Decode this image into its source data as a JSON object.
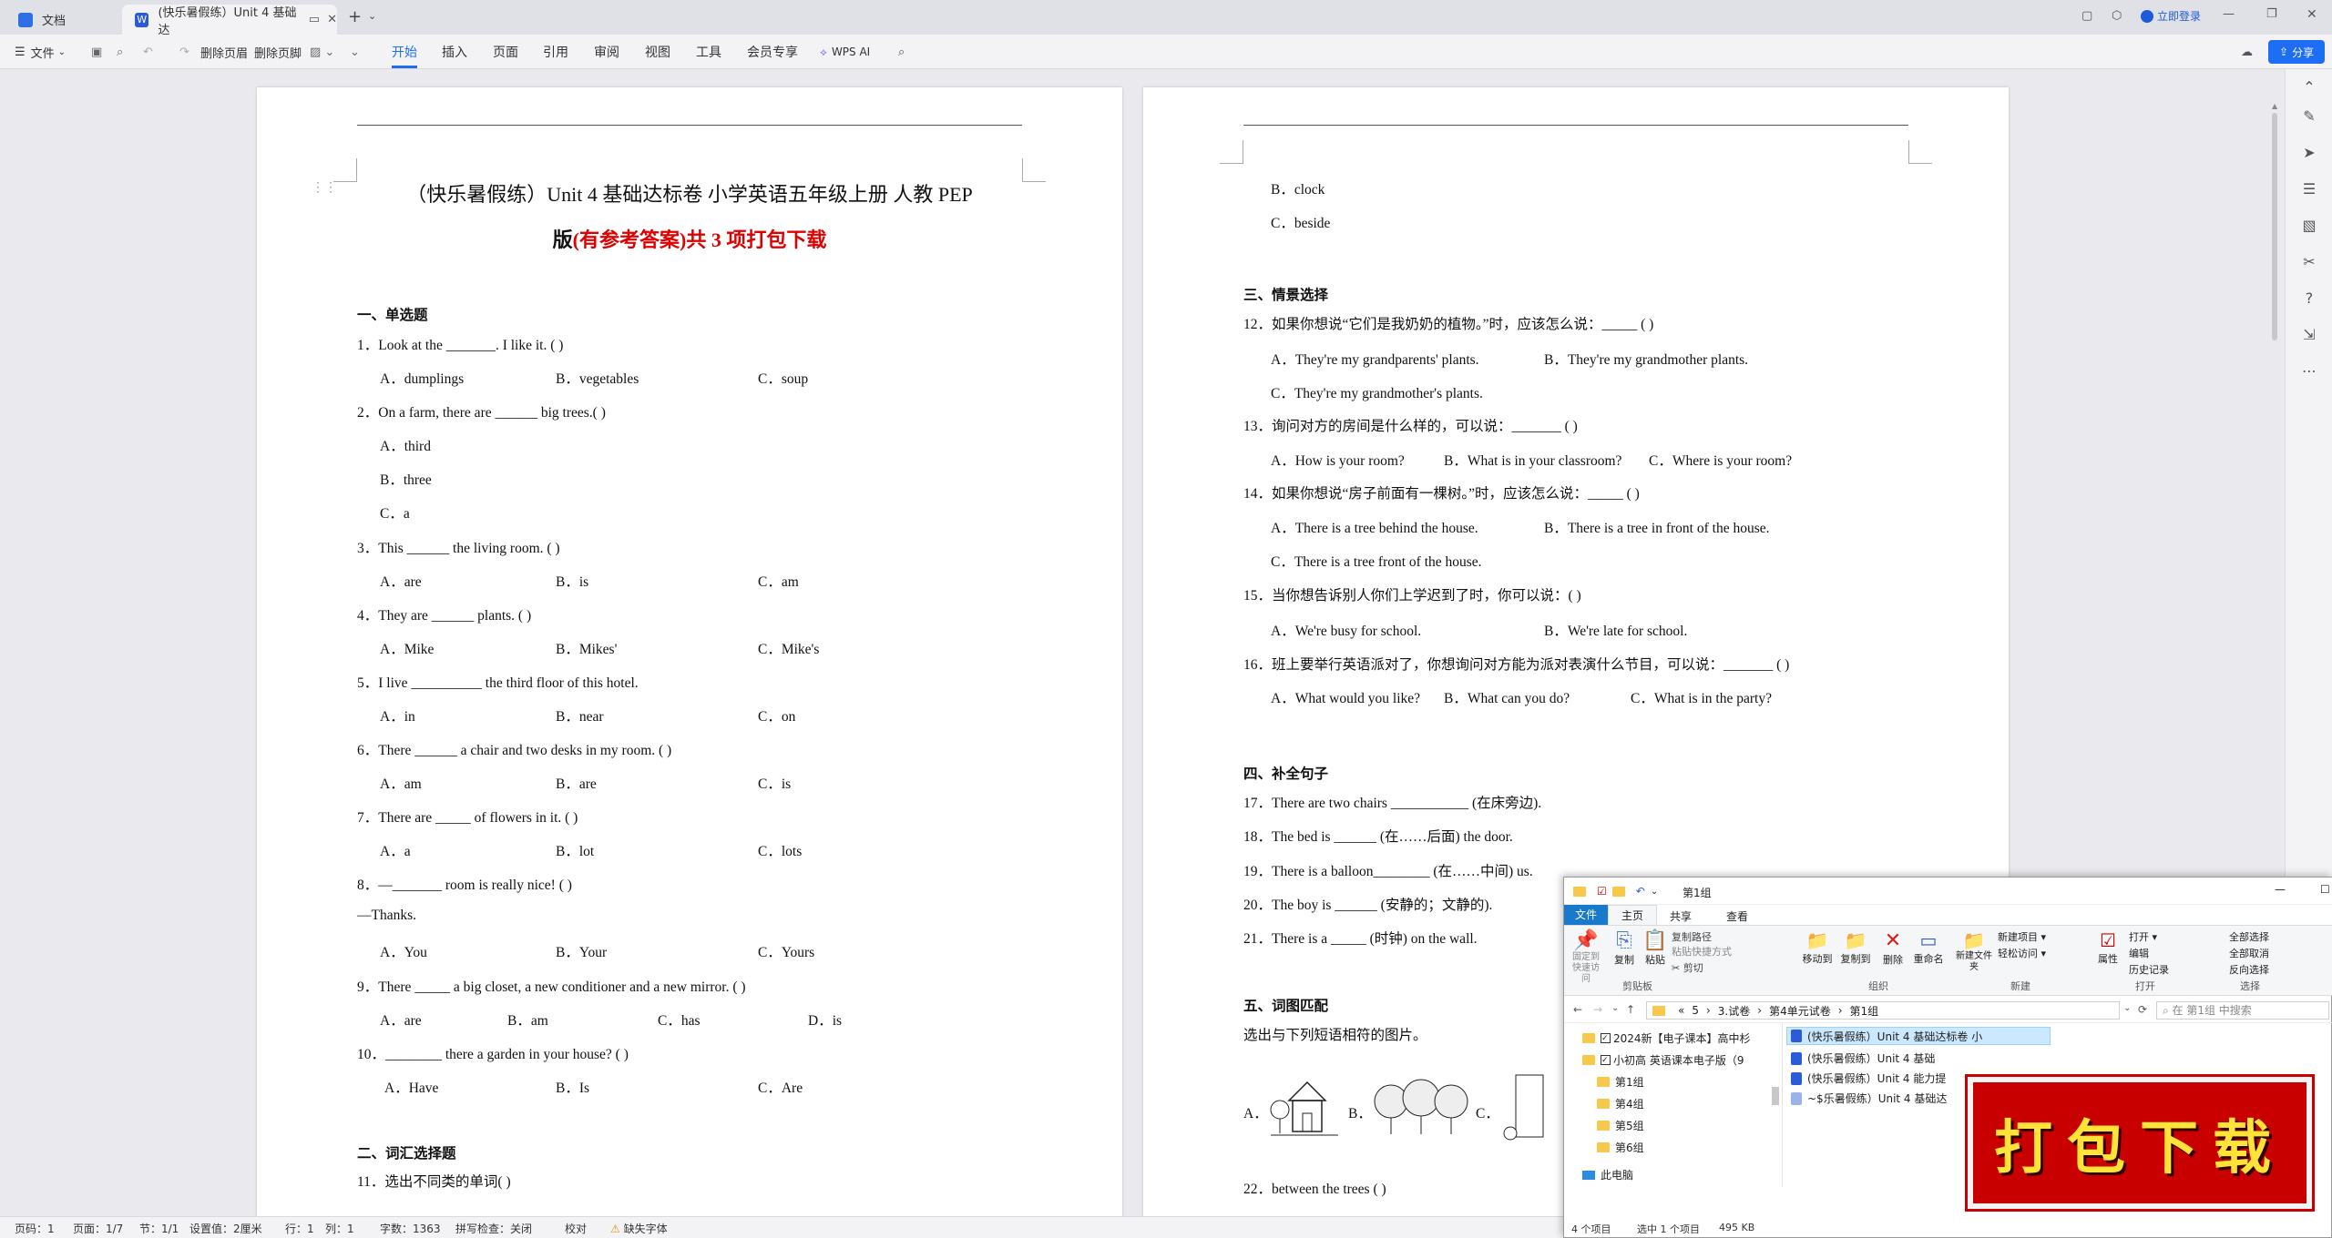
{
  "tabs": [
    {
      "label": "文档"
    },
    {
      "label": "(快乐暑假练）Unit 4  基础达"
    }
  ],
  "titlebar": {
    "login_label": "立即登录"
  },
  "toolbar": {
    "file_label": "文件",
    "delete_header": "删除页眉",
    "delete_footer": "删除页脚",
    "menus": [
      "开始",
      "插入",
      "页面",
      "引用",
      "审阅",
      "视图",
      "工具",
      "会员专享"
    ],
    "wps_ai": "WPS AI",
    "share_label": "分享"
  },
  "page1": {
    "title_line1": "（快乐暑假练）Unit 4   基础达标卷  小学英语五年级上册   人教 PEP",
    "title_line2_prefix": "版",
    "title_line2_red": "(有参考答案)共 3 项打包下载",
    "section1": "一、单选题",
    "q1": "1．Look at the _______. I like it. (    )",
    "q1_opts": [
      "A．dumplings",
      "B．vegetables",
      "C．soup"
    ],
    "q2": "2．On a farm, there are ______ big trees.(    )",
    "q2_opts": [
      "A．third",
      "B．three",
      "C．a"
    ],
    "q3": "3．This ______ the living room. (    )",
    "q3_opts": [
      "A．are",
      "B．is",
      "C．am"
    ],
    "q4": "4．They are ______ plants. (    )",
    "q4_opts": [
      "A．Mike",
      "B．Mikes'",
      "C．Mike's"
    ],
    "q5": "5．I live __________ the third floor of this hotel.",
    "q5_opts": [
      "A．in",
      "B．near",
      "C．on"
    ],
    "q6": "6．There ______ a chair and two desks in my room. (    )",
    "q6_opts": [
      "A．am",
      "B．are",
      "C．is"
    ],
    "q7": "7．There are _____ of flowers in it.   (    )",
    "q7_opts": [
      "A．a",
      "B．lot",
      "C．lots"
    ],
    "q8": "8．—_______ room is really nice! (    )",
    "q8_b": "—Thanks.",
    "q8_opts": [
      "A．You",
      "B．Your",
      "C．Yours"
    ],
    "q9": "9．There _____ a big closet, a new conditioner and a new mirror. (    )",
    "q9_opts": [
      "A．are",
      "B．am",
      "C．has",
      "D．is"
    ],
    "q10": "10．________ there a garden in your house? (    )",
    "q10_opts": [
      "A．Have",
      "B．Is",
      "C．Are"
    ],
    "section2": "二、词汇选择题",
    "q11": "11．选出不同类的单词(    )"
  },
  "page2": {
    "top_opts": [
      "B．clock",
      "C．beside"
    ],
    "section3": "三、情景选择",
    "q12": "12．如果你想说“它们是我奶奶的植物。”时，应该怎么说：_____ (    )",
    "q12_opts": [
      "A．They're my grandparents' plants.",
      "B．They're my grandmother plants.",
      "C．They're my grandmother's plants."
    ],
    "q13": "13．询问对方的房间是什么样的，可以说：_______ (    )",
    "q13_opts": [
      "A．How is your room?",
      "B．What is in your classroom?",
      "C．Where is your room?"
    ],
    "q14": "14．如果你想说“房子前面有一棵树。”时，应该怎么说：_____ (    )",
    "q14_opts": [
      "A．There is a tree behind the house.",
      "B．There is a tree in front of the house.",
      "C．There is a tree front of the house."
    ],
    "q15": "15．当你想告诉别人你们上学迟到了时，你可以说：(    )",
    "q15_opts": [
      "A．We're busy for school.",
      "B．We're late for school."
    ],
    "q16": "16．班上要举行英语派对了，你想询问对方能为派对表演什么节目，可以说：_______ (    )",
    "q16_opts": [
      "A．What would you like?",
      "B．What can you do?",
      "C．What is in the party?"
    ],
    "section4": "四、补全句子",
    "q17": "17．There are two chairs ___________ (在床旁边).",
    "q18": "18．The bed is ______ (在……后面) the door.",
    "q19": "19．There is a balloon________ (在……中间) us.",
    "q20": "20．The boy is ______ (安静的；文静的).",
    "q21": "21．There is a _____ (时钟) on the wall.",
    "section5": "五、词图匹配",
    "s5_instr": "选出与下列短语相符的图片。",
    "img_labels": [
      "A．",
      "B．",
      "C．"
    ],
    "q22": "22．between the trees (        )"
  },
  "statusbar": {
    "items": [
      "页码：1",
      "页面：1/7",
      "节：1/1",
      "设置值：2厘米",
      "行：1",
      "列：1",
      "字数：1363",
      "拼写检查：关闭",
      "校对",
      "缺失字体"
    ]
  },
  "explorer": {
    "title": "第1组",
    "tabs": [
      "文件",
      "主页",
      "共享",
      "查看"
    ],
    "ribbon_buttons": [
      "固定到快速访问",
      "复制",
      "粘贴",
      "复制路径",
      "粘贴快捷方式",
      "剪切",
      "移动到",
      "复制到",
      "删除",
      "重命名",
      "新建文件夹",
      "新建项目",
      "轻松访问",
      "属性",
      "打开",
      "编辑",
      "历史记录",
      "全部选择",
      "全部取消",
      "反向选择"
    ],
    "groups": [
      "剪贴板",
      "组织",
      "新建",
      "打开",
      "选择"
    ],
    "path": [
      "«",
      "5",
      "3.试卷",
      "第4单元试卷",
      "第1组"
    ],
    "search_placeholder": "在 第1组 中搜索",
    "nav_items": [
      "2024新【电子课本】高中杉",
      "小初高 英语课本电子版（9",
      "第1组",
      "第4组",
      "第5组",
      "第6组",
      "此电脑"
    ],
    "files": [
      "(快乐暑假练）Unit 4  基础达标卷  小",
      "(快乐暑假练）Unit 4  基础",
      "(快乐暑假练）Unit 4  能力提",
      "~$乐暑假练）Unit 4  基础达"
    ],
    "status": [
      "4 个项目",
      "选中 1 个项目",
      "495 KB"
    ]
  },
  "promo": {
    "text": "打包下载"
  }
}
